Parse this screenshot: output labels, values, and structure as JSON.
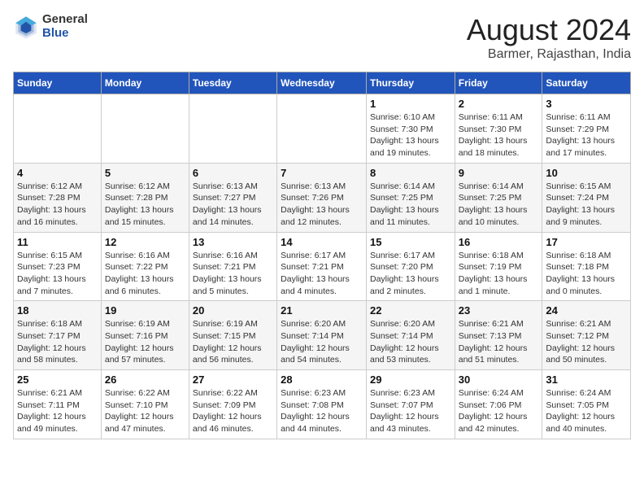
{
  "header": {
    "logo_general": "General",
    "logo_blue": "Blue",
    "month_title": "August 2024",
    "location": "Barmer, Rajasthan, India"
  },
  "days_of_week": [
    "Sunday",
    "Monday",
    "Tuesday",
    "Wednesday",
    "Thursday",
    "Friday",
    "Saturday"
  ],
  "weeks": [
    [
      {
        "day": "",
        "info": ""
      },
      {
        "day": "",
        "info": ""
      },
      {
        "day": "",
        "info": ""
      },
      {
        "day": "",
        "info": ""
      },
      {
        "day": "1",
        "info": "Sunrise: 6:10 AM\nSunset: 7:30 PM\nDaylight: 13 hours\nand 19 minutes."
      },
      {
        "day": "2",
        "info": "Sunrise: 6:11 AM\nSunset: 7:30 PM\nDaylight: 13 hours\nand 18 minutes."
      },
      {
        "day": "3",
        "info": "Sunrise: 6:11 AM\nSunset: 7:29 PM\nDaylight: 13 hours\nand 17 minutes."
      }
    ],
    [
      {
        "day": "4",
        "info": "Sunrise: 6:12 AM\nSunset: 7:28 PM\nDaylight: 13 hours\nand 16 minutes."
      },
      {
        "day": "5",
        "info": "Sunrise: 6:12 AM\nSunset: 7:28 PM\nDaylight: 13 hours\nand 15 minutes."
      },
      {
        "day": "6",
        "info": "Sunrise: 6:13 AM\nSunset: 7:27 PM\nDaylight: 13 hours\nand 14 minutes."
      },
      {
        "day": "7",
        "info": "Sunrise: 6:13 AM\nSunset: 7:26 PM\nDaylight: 13 hours\nand 12 minutes."
      },
      {
        "day": "8",
        "info": "Sunrise: 6:14 AM\nSunset: 7:25 PM\nDaylight: 13 hours\nand 11 minutes."
      },
      {
        "day": "9",
        "info": "Sunrise: 6:14 AM\nSunset: 7:25 PM\nDaylight: 13 hours\nand 10 minutes."
      },
      {
        "day": "10",
        "info": "Sunrise: 6:15 AM\nSunset: 7:24 PM\nDaylight: 13 hours\nand 9 minutes."
      }
    ],
    [
      {
        "day": "11",
        "info": "Sunrise: 6:15 AM\nSunset: 7:23 PM\nDaylight: 13 hours\nand 7 minutes."
      },
      {
        "day": "12",
        "info": "Sunrise: 6:16 AM\nSunset: 7:22 PM\nDaylight: 13 hours\nand 6 minutes."
      },
      {
        "day": "13",
        "info": "Sunrise: 6:16 AM\nSunset: 7:21 PM\nDaylight: 13 hours\nand 5 minutes."
      },
      {
        "day": "14",
        "info": "Sunrise: 6:17 AM\nSunset: 7:21 PM\nDaylight: 13 hours\nand 4 minutes."
      },
      {
        "day": "15",
        "info": "Sunrise: 6:17 AM\nSunset: 7:20 PM\nDaylight: 13 hours\nand 2 minutes."
      },
      {
        "day": "16",
        "info": "Sunrise: 6:18 AM\nSunset: 7:19 PM\nDaylight: 13 hours\nand 1 minute."
      },
      {
        "day": "17",
        "info": "Sunrise: 6:18 AM\nSunset: 7:18 PM\nDaylight: 13 hours\nand 0 minutes."
      }
    ],
    [
      {
        "day": "18",
        "info": "Sunrise: 6:18 AM\nSunset: 7:17 PM\nDaylight: 12 hours\nand 58 minutes."
      },
      {
        "day": "19",
        "info": "Sunrise: 6:19 AM\nSunset: 7:16 PM\nDaylight: 12 hours\nand 57 minutes."
      },
      {
        "day": "20",
        "info": "Sunrise: 6:19 AM\nSunset: 7:15 PM\nDaylight: 12 hours\nand 56 minutes."
      },
      {
        "day": "21",
        "info": "Sunrise: 6:20 AM\nSunset: 7:14 PM\nDaylight: 12 hours\nand 54 minutes."
      },
      {
        "day": "22",
        "info": "Sunrise: 6:20 AM\nSunset: 7:14 PM\nDaylight: 12 hours\nand 53 minutes."
      },
      {
        "day": "23",
        "info": "Sunrise: 6:21 AM\nSunset: 7:13 PM\nDaylight: 12 hours\nand 51 minutes."
      },
      {
        "day": "24",
        "info": "Sunrise: 6:21 AM\nSunset: 7:12 PM\nDaylight: 12 hours\nand 50 minutes."
      }
    ],
    [
      {
        "day": "25",
        "info": "Sunrise: 6:21 AM\nSunset: 7:11 PM\nDaylight: 12 hours\nand 49 minutes."
      },
      {
        "day": "26",
        "info": "Sunrise: 6:22 AM\nSunset: 7:10 PM\nDaylight: 12 hours\nand 47 minutes."
      },
      {
        "day": "27",
        "info": "Sunrise: 6:22 AM\nSunset: 7:09 PM\nDaylight: 12 hours\nand 46 minutes."
      },
      {
        "day": "28",
        "info": "Sunrise: 6:23 AM\nSunset: 7:08 PM\nDaylight: 12 hours\nand 44 minutes."
      },
      {
        "day": "29",
        "info": "Sunrise: 6:23 AM\nSunset: 7:07 PM\nDaylight: 12 hours\nand 43 minutes."
      },
      {
        "day": "30",
        "info": "Sunrise: 6:24 AM\nSunset: 7:06 PM\nDaylight: 12 hours\nand 42 minutes."
      },
      {
        "day": "31",
        "info": "Sunrise: 6:24 AM\nSunset: 7:05 PM\nDaylight: 12 hours\nand 40 minutes."
      }
    ]
  ]
}
